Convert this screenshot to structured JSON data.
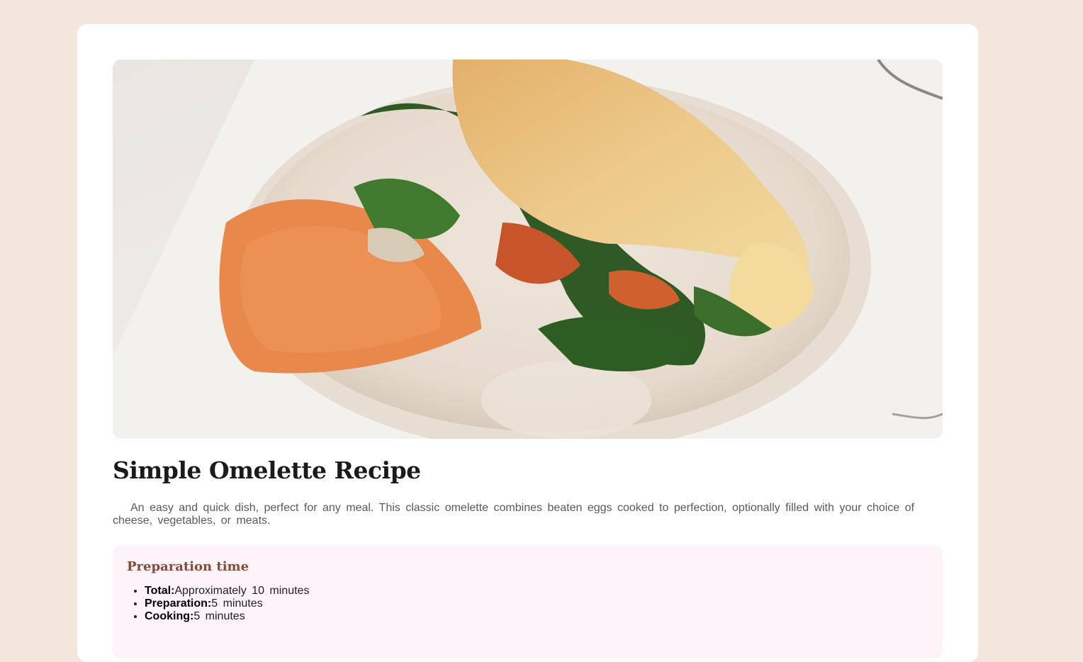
{
  "recipe": {
    "title": "Simple Omelette Recipe",
    "description": "An easy and quick dish, perfect for any meal. This classic omelette combines beaten eggs cooked to perfection, optionally filled with your choice of cheese, vegetables, or meats."
  },
  "preparation": {
    "heading": "Preparation time",
    "items": [
      {
        "label": "Total:",
        "value": "Approximately 10 minutes"
      },
      {
        "label": "Preparation:",
        "value": "5 minutes"
      },
      {
        "label": "Cooking:",
        "value": "5 minutes"
      }
    ]
  },
  "colors": {
    "page_background": "#f3e6da",
    "card_background": "#ffffff",
    "prep_background": "#fdf3f8",
    "heading_accent": "#854a3a"
  }
}
